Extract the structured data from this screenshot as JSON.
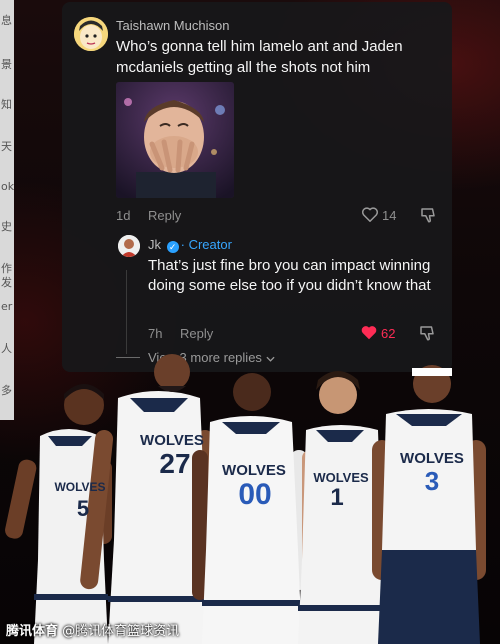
{
  "comment": {
    "author": "Taishawn Muchison",
    "text": "Who’s gonna tell him lamelo ant and Jaden mcdaniels getting all the shots not him",
    "age": "1d",
    "reply_label": "Reply",
    "like_count": "14"
  },
  "reply": {
    "author": "Jk",
    "badge": "Creator",
    "separator": "·",
    "text": "That’s just fine bro you can impact winning doing some else too if you didn’t know that",
    "age": "7h",
    "reply_label": "Reply",
    "like_count": "62",
    "like_color": "#fe2c55"
  },
  "view_replies_label": "View 3 more replies",
  "players": [
    {
      "team": "WOLVES",
      "number": "5"
    },
    {
      "team": "WOLVES",
      "number": "27"
    },
    {
      "team": "WOLVES",
      "number": "00"
    },
    {
      "team": "WOLVES",
      "number": "1"
    },
    {
      "team": "WOLVES",
      "number": "3"
    }
  ],
  "left_strip_chars": [
    "息",
    "景",
    "知",
    "天",
    "ok",
    "史",
    "作",
    "发",
    "er",
    "人",
    "多"
  ],
  "watermark": {
    "brand": "腾讯体育",
    "handle": "@腾讯体育篮球资讯"
  },
  "icons": {
    "heart": "heart-outline-icon",
    "heart_filled": "heart-filled-icon",
    "dislike": "dislike-icon",
    "verified": "verified-check-icon",
    "chevron": "chevron-down-icon"
  }
}
